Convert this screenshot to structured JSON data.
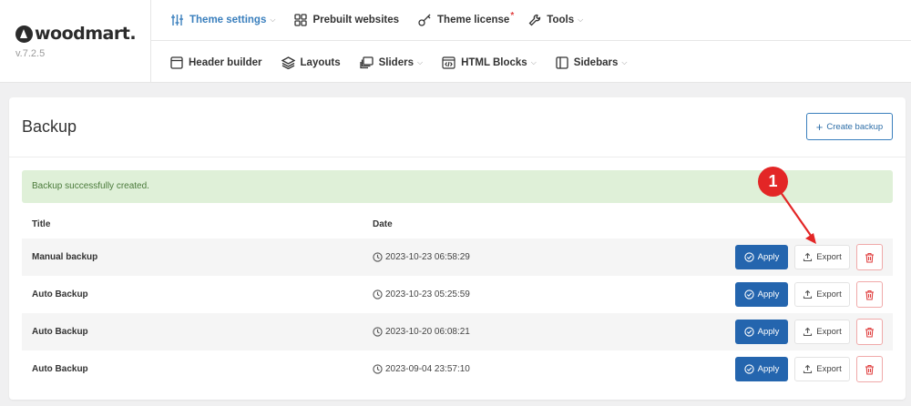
{
  "brand": {
    "name": "woodmart.",
    "version": "v.7.2.5"
  },
  "nav": {
    "row1": [
      {
        "label": "Theme settings",
        "icon": "sliders-icon",
        "dropdown": true,
        "active": true
      },
      {
        "label": "Prebuilt websites",
        "icon": "grid-icon",
        "dropdown": false
      },
      {
        "label": "Theme license",
        "icon": "key-icon",
        "dropdown": false,
        "badge": "*"
      },
      {
        "label": "Tools",
        "icon": "wrench-icon",
        "dropdown": true
      }
    ],
    "row2": [
      {
        "label": "Header builder",
        "icon": "window-icon",
        "dropdown": false
      },
      {
        "label": "Layouts",
        "icon": "layers-icon",
        "dropdown": false
      },
      {
        "label": "Sliders",
        "icon": "slides-icon",
        "dropdown": true
      },
      {
        "label": "HTML Blocks",
        "icon": "code-window-icon",
        "dropdown": true
      },
      {
        "label": "Sidebars",
        "icon": "sidebar-icon",
        "dropdown": true
      }
    ]
  },
  "page": {
    "title": "Backup",
    "create_label": "Create backup",
    "notice": "Backup successfully created.",
    "columns": {
      "title": "Title",
      "date": "Date"
    },
    "apply_label": "Apply",
    "export_label": "Export"
  },
  "backups": [
    {
      "title": "Manual backup",
      "date": "2023-10-23 06:58:29"
    },
    {
      "title": "Auto Backup",
      "date": "2023-10-23 05:25:59"
    },
    {
      "title": "Auto Backup",
      "date": "2023-10-20 06:08:21"
    },
    {
      "title": "Auto Backup",
      "date": "2023-09-04 23:57:10"
    }
  ],
  "annotation": {
    "number": "1"
  },
  "colors": {
    "accent": "#3a7fbd",
    "apply": "#2465ae",
    "success_bg": "#dff0d8",
    "danger": "#e04040",
    "marker": "#e32626"
  }
}
